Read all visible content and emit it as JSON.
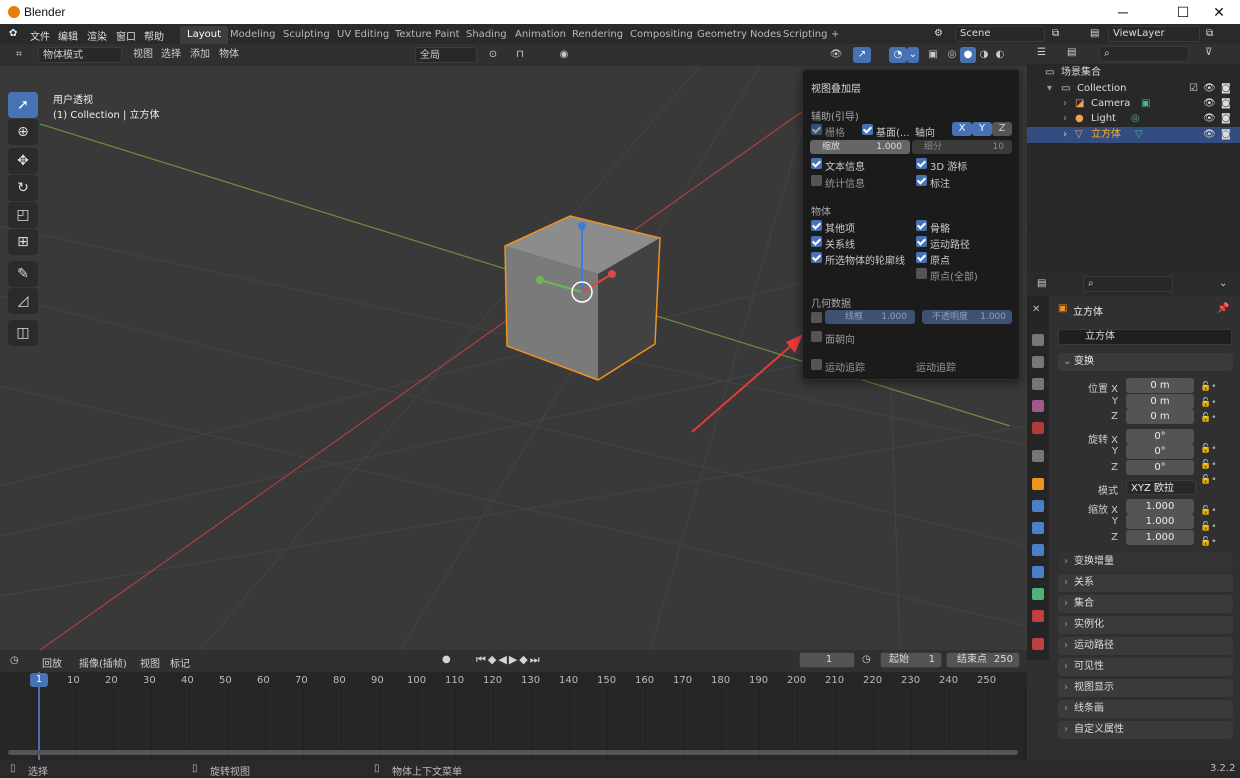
{
  "window": {
    "title": "Blender",
    "controls": [
      "─",
      "☐",
      "✕"
    ]
  },
  "menu": [
    "文件",
    "编辑",
    "渲染",
    "窗口",
    "帮助"
  ],
  "workspaces": [
    "Layout",
    "Modeling",
    "Sculpting",
    "UV Editing",
    "Texture Paint",
    "Shading",
    "Animation",
    "Rendering",
    "Compositing",
    "Geometry Nodes",
    "Scripting",
    "+"
  ],
  "scene": "Scene",
  "view_layer": "ViewLayer",
  "viewport_header": {
    "mode": "物体模式",
    "items": [
      "视图",
      "选择",
      "添加",
      "物体"
    ],
    "transform": "全局"
  },
  "viewport_info": {
    "line1": "用户透视",
    "line2": "(1) Collection | 立方体"
  },
  "overlay": {
    "title": "视图叠加层",
    "guides_heading": "辅助(引导)",
    "grid": "栅格",
    "floor": "基面(...",
    "axes_label": "轴向",
    "axes": [
      "X",
      "Y",
      "Z"
    ],
    "scale_label": "缩放",
    "scale_value": "1.000",
    "subdiv_label": "细分",
    "subdiv_value": "10",
    "text_info": "文本信息",
    "cursor_3d": "3D 游标",
    "stats": "统计信息",
    "annotations": "标注",
    "objects_heading": "物体",
    "extras": "其他项",
    "bones": "骨骼",
    "relations": "关系线",
    "motion_paths": "运动路径",
    "outline_selected": "所选物体的轮廓线",
    "origins": "原点",
    "origins_all": "原点(全部)",
    "geometry_heading": "几何数据",
    "wireframe_label": "线框",
    "wireframe_value": "1.000",
    "opacity_label": "不透明度",
    "opacity_value": "1.000",
    "face_orientation": "面朝向",
    "motion_tracking": "运动追踪",
    "motion_tracking2": "运动追踪"
  },
  "outliner": {
    "root": "场景集合",
    "collection": "Collection",
    "items": [
      "Camera",
      "Light",
      "立方体"
    ]
  },
  "properties": {
    "object_name": "立方体",
    "data_name": "立方体",
    "transform": "变换",
    "location_label": "位置 X",
    "loc": [
      "0 m",
      "0 m",
      "0 m"
    ],
    "rotation_label": "旋转 X",
    "rot": [
      "0°",
      "0°",
      "0°"
    ],
    "mode_label": "模式",
    "mode_value": "XYZ 欧拉",
    "scale_label": "缩放 X",
    "scale": [
      "1.000",
      "1.000",
      "1.000"
    ],
    "y": "Y",
    "z": "Z",
    "delta": "变换增量",
    "panels": [
      "关系",
      "集合",
      "实例化",
      "运动路径",
      "可见性",
      "视图显示",
      "线条画",
      "自定义属性"
    ]
  },
  "timeline": {
    "menus": [
      "回放",
      "摇像(插帧)",
      "视图",
      "标记"
    ],
    "current": "1",
    "start_label": "起始",
    "start": "1",
    "end_label": "结束点",
    "end": "250",
    "ticks": [
      "1",
      "10",
      "20",
      "30",
      "40",
      "50",
      "60",
      "70",
      "80",
      "90",
      "100",
      "110",
      "120",
      "130",
      "140",
      "150",
      "160",
      "170",
      "180",
      "190",
      "200",
      "210",
      "220",
      "230",
      "240",
      "250"
    ]
  },
  "status": {
    "select": "选择",
    "rotate": "旋转视图",
    "context": "物体上下文菜单",
    "version": "3.2.2"
  },
  "colors": {
    "accent": "#4772b3",
    "select_orange": "#f0941c"
  }
}
